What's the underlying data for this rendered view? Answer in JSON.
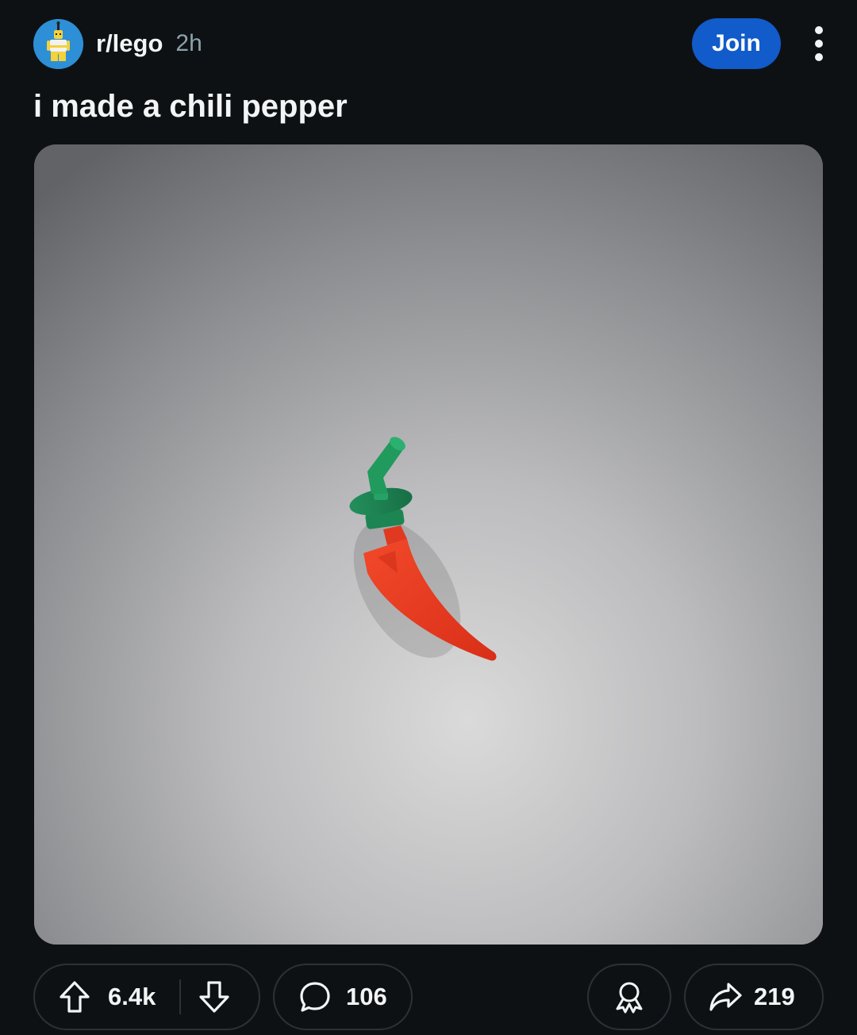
{
  "header": {
    "subreddit": "r/lego",
    "age": "2h",
    "join_label": "Join",
    "avatar_icon": "lego-minifigure-icon",
    "more_icon": "more-vertical-icon"
  },
  "post": {
    "title": "i made a chili pepper",
    "image_subject": "lego-chili-pepper"
  },
  "actions": {
    "upvote_icon": "arrow-up-icon",
    "vote_count": "6.4k",
    "downvote_icon": "arrow-down-icon",
    "comment_icon": "comment-bubble-icon",
    "comment_count": "106",
    "award_icon": "award-icon",
    "share_icon": "share-arrow-icon",
    "share_count": "219"
  },
  "colors": {
    "background": "#0e1113",
    "join_button": "#115bca",
    "avatar_background": "#2d8fd6",
    "muted_text": "#8ba2ad",
    "pill_border": "#2a3236",
    "pepper_red": "#e53a20",
    "stem_green": "#1f8f58"
  }
}
